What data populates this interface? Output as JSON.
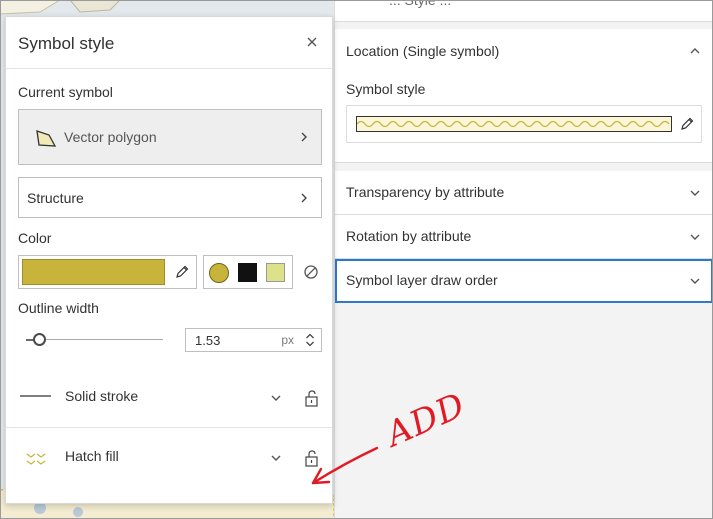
{
  "panel": {
    "title": "Symbol style",
    "close_icon": "close-icon",
    "current_symbol_label": "Current symbol",
    "current_symbol_name": "Vector polygon",
    "structure_label": "Structure",
    "color_label": "Color",
    "color_value": "#c8b43a",
    "quick_colors": [
      "#c8b43a",
      "#111111",
      "#dde28a"
    ],
    "outline_width_label": "Outline width",
    "outline_width_value": "1.53",
    "outline_width_unit": "px",
    "outline_width_slider_fraction": 0.1,
    "layers": [
      {
        "label": "Solid stroke",
        "icon": "solid-stroke-icon"
      },
      {
        "label": "Hatch fill",
        "icon": "hatch-fill-icon"
      }
    ]
  },
  "right_pane": {
    "top_strip_text": "... Style ...",
    "location_header": "Location (Single symbol)",
    "symbol_style_label": "Symbol style",
    "sections": [
      {
        "label": "Transparency by attribute"
      },
      {
        "label": "Rotation by attribute"
      },
      {
        "label": "Symbol layer draw order"
      }
    ]
  },
  "annotation": {
    "text": "ADD",
    "color": "#e01b24"
  }
}
